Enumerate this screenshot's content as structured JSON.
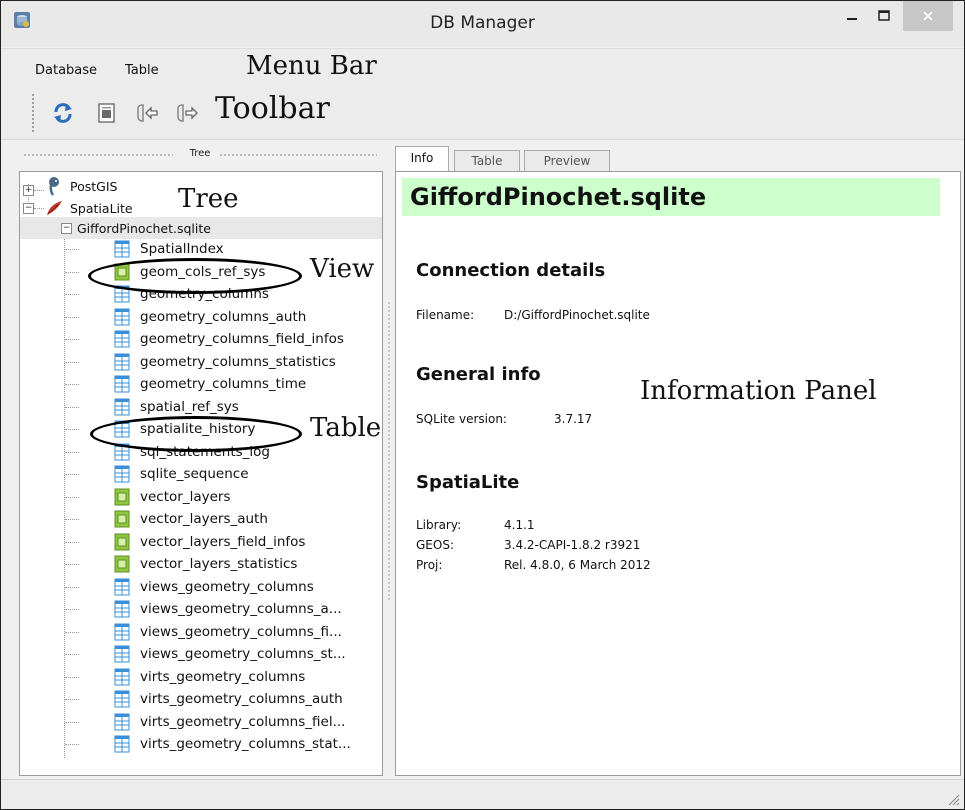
{
  "window": {
    "title": "DB Manager"
  },
  "menu": {
    "items": [
      "Database",
      "Table"
    ]
  },
  "annotations": {
    "menu_bar": "Menu Bar",
    "toolbar": "Toolbar",
    "tree": "Tree",
    "view": "View",
    "table": "Table",
    "information_panel": "Information Panel"
  },
  "toolbar": {
    "buttons": [
      "refresh-icon",
      "sql-window-icon",
      "import-layer-icon",
      "export-layer-icon"
    ]
  },
  "tree": {
    "header": "Tree",
    "providers": [
      "PostGIS",
      "SpatiaLite"
    ],
    "database": "GiffordPinochet.sqlite",
    "items": [
      {
        "label": "SpatialIndex",
        "kind": "table"
      },
      {
        "label": "geom_cols_ref_sys",
        "kind": "view"
      },
      {
        "label": "geometry_columns",
        "kind": "table"
      },
      {
        "label": "geometry_columns_auth",
        "kind": "table"
      },
      {
        "label": "geometry_columns_field_infos",
        "kind": "table"
      },
      {
        "label": "geometry_columns_statistics",
        "kind": "table"
      },
      {
        "label": "geometry_columns_time",
        "kind": "table"
      },
      {
        "label": "spatial_ref_sys",
        "kind": "table"
      },
      {
        "label": "spatialite_history",
        "kind": "table"
      },
      {
        "label": "sql_statements_log",
        "kind": "table"
      },
      {
        "label": "sqlite_sequence",
        "kind": "table"
      },
      {
        "label": "vector_layers",
        "kind": "view"
      },
      {
        "label": "vector_layers_auth",
        "kind": "view"
      },
      {
        "label": "vector_layers_field_infos",
        "kind": "view"
      },
      {
        "label": "vector_layers_statistics",
        "kind": "view"
      },
      {
        "label": "views_geometry_columns",
        "kind": "table"
      },
      {
        "label": "views_geometry_columns_a...",
        "kind": "table"
      },
      {
        "label": "views_geometry_columns_fi...",
        "kind": "table"
      },
      {
        "label": "views_geometry_columns_st...",
        "kind": "table"
      },
      {
        "label": "virts_geometry_columns",
        "kind": "table"
      },
      {
        "label": "virts_geometry_columns_auth",
        "kind": "table"
      },
      {
        "label": "virts_geometry_columns_fiel...",
        "kind": "table"
      },
      {
        "label": "virts_geometry_columns_stat...",
        "kind": "table"
      }
    ]
  },
  "tabs": [
    {
      "label": "Info",
      "active": true
    },
    {
      "label": "Table",
      "active": false
    },
    {
      "label": "Preview",
      "active": false
    }
  ],
  "info": {
    "title": "GiffordPinochet.sqlite",
    "connection_heading": "Connection details",
    "filename_label": "Filename:",
    "filename_value": "D:/GiffordPinochet.sqlite",
    "general_heading": "General info",
    "sqlite_version_label": "SQLite version:",
    "sqlite_version_value": "3.7.17",
    "spatialite_heading": "SpatiaLite",
    "library_label": "Library:",
    "library_value": "4.1.1",
    "geos_label": "GEOS:",
    "geos_value": "3.4.2-CAPI-1.8.2 r3921",
    "proj_label": "Proj:",
    "proj_value": "Rel. 4.8.0, 6 March 2012"
  },
  "colors": {
    "title_highlight": "#ccffcc",
    "view_icon": "#8dc63f",
    "table_icon": "#3a8fd8"
  }
}
